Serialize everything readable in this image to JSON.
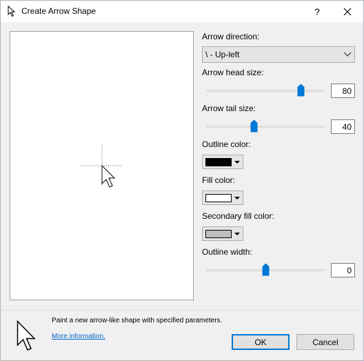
{
  "window": {
    "title": "Create Arrow Shape",
    "help_label": "?"
  },
  "fields": {
    "direction_label": "Arrow direction:",
    "direction_value": "\\ - Up-left",
    "head_size_label": "Arrow head size:",
    "head_size_value": "80",
    "head_size_fraction": 0.8,
    "tail_size_label": "Arrow tail size:",
    "tail_size_value": "40",
    "tail_size_fraction": 0.4,
    "outline_color_label": "Outline color:",
    "outline_color": "#000000",
    "fill_color_label": "Fill color:",
    "fill_color": "#ffffff",
    "secondary_fill_label": "Secondary fill color:",
    "secondary_fill_color": "#c0c0c0",
    "outline_width_label": "Outline width:",
    "outline_width_value": "0",
    "outline_width_fraction": 0.5
  },
  "footer": {
    "description": "Paint a new arrow-like shape with specified parameters.",
    "more_info": "More information.",
    "ok_label": "OK",
    "cancel_label": "Cancel"
  },
  "colors": {
    "accent": "#0078d7"
  }
}
